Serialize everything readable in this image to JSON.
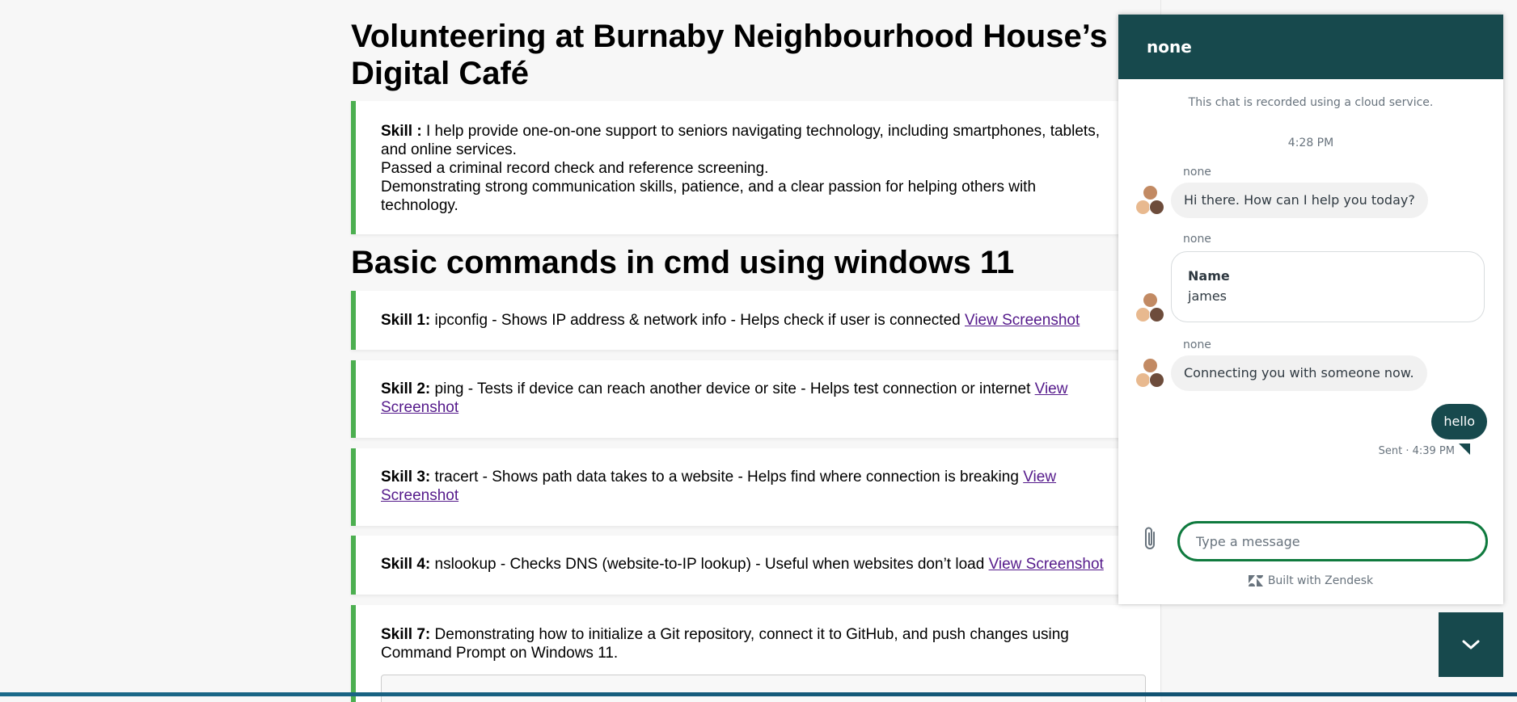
{
  "page": {
    "volunteer_heading": "Volunteering at Burnaby Neighbourhood House’s Digital Café",
    "volunteer_card": {
      "label": "Skill :",
      "line1": " I help provide one-on-one support to seniors navigating technology, including smartphones, tablets,",
      "line2": "and online services.",
      "line3": "Passed a criminal record check and reference screening.",
      "line4": "Demonstrating strong communication skills, patience, and a clear passion for helping others with",
      "line5": "technology."
    },
    "cmd_heading": "Basic commands in cmd using windows 11",
    "skills": [
      {
        "label": "Skill 1:",
        "text": " ipconfig - Shows IP address & network info - Helps check if user is connected ",
        "link": "View Screenshot"
      },
      {
        "label": "Skill 2:",
        "text": " ping - Tests if device can reach another device or site - Helps test connection or internet ",
        "link_part1": "View",
        "link_part2": "Screenshot"
      },
      {
        "label": "Skill 3:",
        "text": " tracert - Shows path data takes to a website - Helps find where connection is breaking ",
        "link_part1": "View",
        "link_part2": "Screenshot"
      },
      {
        "label": "Skill 4:",
        "text": " nslookup - Checks DNS (website-to-IP lookup) - Useful when websites don’t load ",
        "link": "View Screenshot"
      },
      {
        "label": "Skill 7:",
        "line1": " Demonstrating how to initialize a Git repository, connect it to GitHub, and push changes using",
        "line2": "Command Prompt on Windows 11."
      }
    ]
  },
  "chat": {
    "title": "none",
    "notice": "This chat is recorded using a cloud service.",
    "time": "4:28 PM",
    "messages": [
      {
        "sender": "none",
        "text": "Hi there. How can I help you today?"
      },
      {
        "sender": "none",
        "form_label": "Name",
        "form_value": "james"
      },
      {
        "sender": "none",
        "text": "Connecting you with someone now."
      }
    ],
    "user_message": "hello",
    "sent_status": "Sent · 4:39 PM",
    "input_placeholder": "Type a message",
    "branding": "Built with Zendesk",
    "colors": {
      "header": "#17494d",
      "input_border": "#0f7a3e",
      "skill_accent": "#4caf50"
    },
    "icons": {
      "attach": "paperclip-icon",
      "launcher": "chevron-down-icon",
      "brand": "zendesk-logo-icon"
    }
  }
}
